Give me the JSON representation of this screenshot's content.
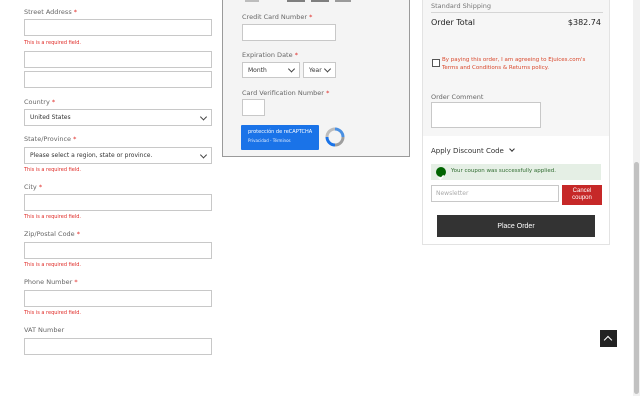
{
  "address": {
    "street_label": "Street Address",
    "country_label": "Country",
    "country_value": "United States",
    "state_label": "State/Province",
    "state_placeholder": "Please select a region, state or province.",
    "city_label": "City",
    "zip_label": "Zip/Postal Code",
    "phone_label": "Phone Number",
    "vat_label": "VAT Number",
    "required_marker": "*",
    "required_msg": "This is a required field."
  },
  "payment": {
    "cc_label": "Credit Card Number",
    "exp_label": "Expiration Date",
    "month_placeholder": "Month",
    "year_placeholder": "Year",
    "cvv_label": "Card Verification Number",
    "recaptcha_title": "protección de reCAPTCHA",
    "recaptcha_links": "Privacidad - Términos"
  },
  "summary": {
    "shipping_method": "Standard Shipping",
    "order_total_label": "Order Total",
    "order_total_value": "$382.74",
    "agreement_text": "By paying this order, I am agreeing to Ejuices.com's Terms and Conditions & Returns policy.",
    "order_comment_label": "Order Comment",
    "discount_toggle": "Apply Discount Code",
    "coupon_success": "Your coupon was successfully applied.",
    "newsletter_placeholder": "Newsletter",
    "cancel_coupon": "Cancel coupon",
    "place_order": "Place Order"
  },
  "colors": {
    "error": "#e02b27",
    "success_bg": "#e5efe5",
    "success_icon": "#006400",
    "recaptcha_blue": "#1a73e8",
    "dark_button": "#333333",
    "cancel_button": "#c62828"
  },
  "icons": [
    "chevron-down-icon",
    "recaptcha-logo-icon",
    "check-circle-icon",
    "back-to-top-icon"
  ]
}
